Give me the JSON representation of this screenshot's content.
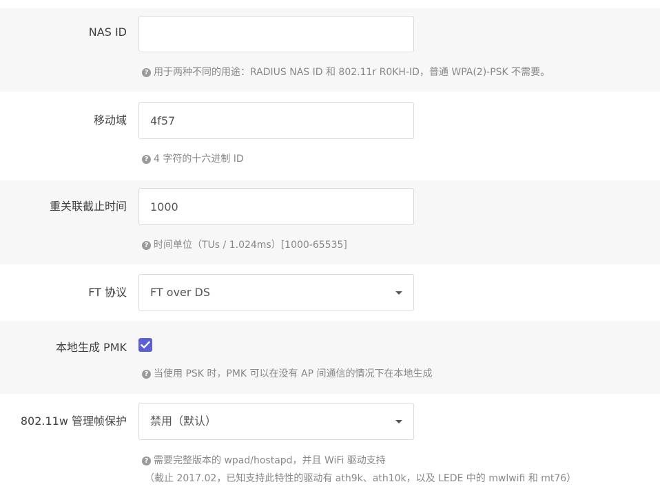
{
  "nas_id": {
    "label": "NAS ID",
    "value": "",
    "description": "用于两种不同的用途：RADIUS NAS ID 和 802.11r R0KH-ID，普通 WPA(2)-PSK 不需要。"
  },
  "mobility_domain": {
    "label": "移动域",
    "value": "4f57",
    "description": "4 字符的十六进制 ID"
  },
  "reassociation_deadline": {
    "label": "重关联截止时间",
    "value": "1000",
    "description": "时间单位（TUs / 1.024ms）[1000-65535]"
  },
  "ft_protocol": {
    "label": "FT 协议",
    "selected": "FT over DS"
  },
  "local_pmk": {
    "label": "本地生成 PMK",
    "checked": true,
    "description": "当使用 PSK 时，PMK 可以在没有 AP 间通信的情况下在本地生成"
  },
  "mgmt_frame_protection": {
    "label": "802.11w 管理帧保护",
    "selected": "禁用（默认）",
    "description_line1": "需要完整版本的 wpad/hostapd，并且 WiFi 驱动支持",
    "description_line2": "（截止 2017.02，已知支持此特性的驱动有 ath9k、ath10k，以及 LEDE 中的 mwlwifi 和 mt76）"
  },
  "colors": {
    "accent": "#5b5fd6",
    "row_alt_bg": "#f7f7f7"
  },
  "icons": {
    "help": "question-circle-icon",
    "dropdown": "caret-down-icon",
    "check": "checkmark-icon"
  }
}
